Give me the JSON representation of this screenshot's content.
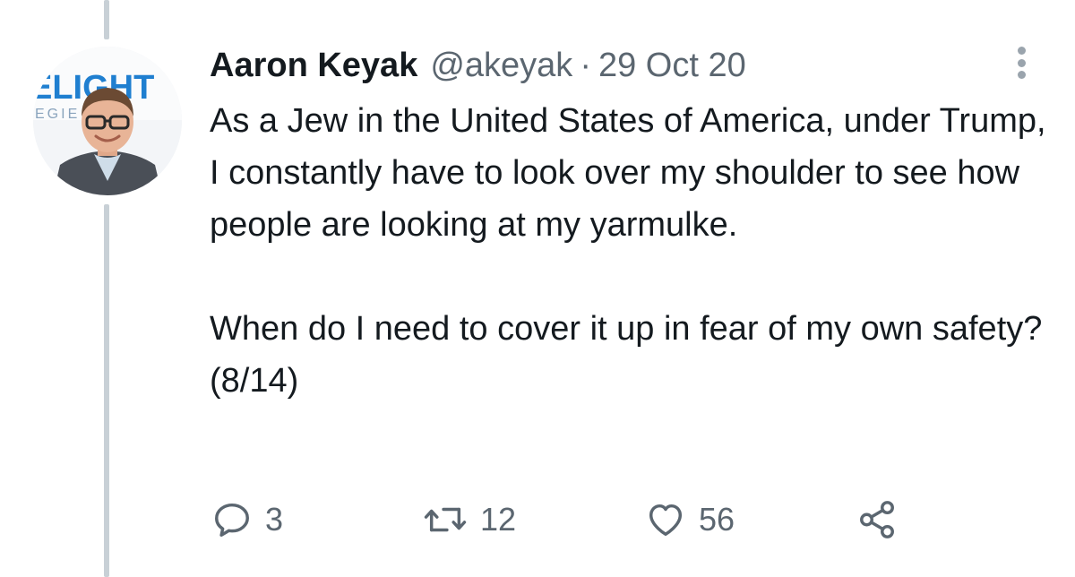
{
  "tweet": {
    "author": {
      "display_name": "Aaron Keyak",
      "handle": "@akeyak",
      "avatar_icon": "profile-photo",
      "avatar_background_text": "ELIGHT",
      "avatar_background_subtext": "EGIE"
    },
    "separator": "·",
    "date": "29 Oct 20",
    "text": {
      "paragraph_1": "As a Jew in the United States of America, under Trump, I constantly have to look over my shoulder to see how people are looking at my yarmulke.",
      "paragraph_2": "When do I need to cover it up in fear of my own safety? (8/14)"
    },
    "more_icon": "more-vertical-icon",
    "actions": {
      "reply": {
        "icon": "reply-icon",
        "count": "3"
      },
      "retweet": {
        "icon": "retweet-icon",
        "count": "12"
      },
      "like": {
        "icon": "heart-icon",
        "count": "56"
      },
      "share": {
        "icon": "share-icon"
      }
    }
  },
  "colors": {
    "text_primary": "#141a1f",
    "text_secondary": "#5b6670",
    "thread_line": "#c8d0d6",
    "avatar_banner_text": "#1f7fd0"
  }
}
